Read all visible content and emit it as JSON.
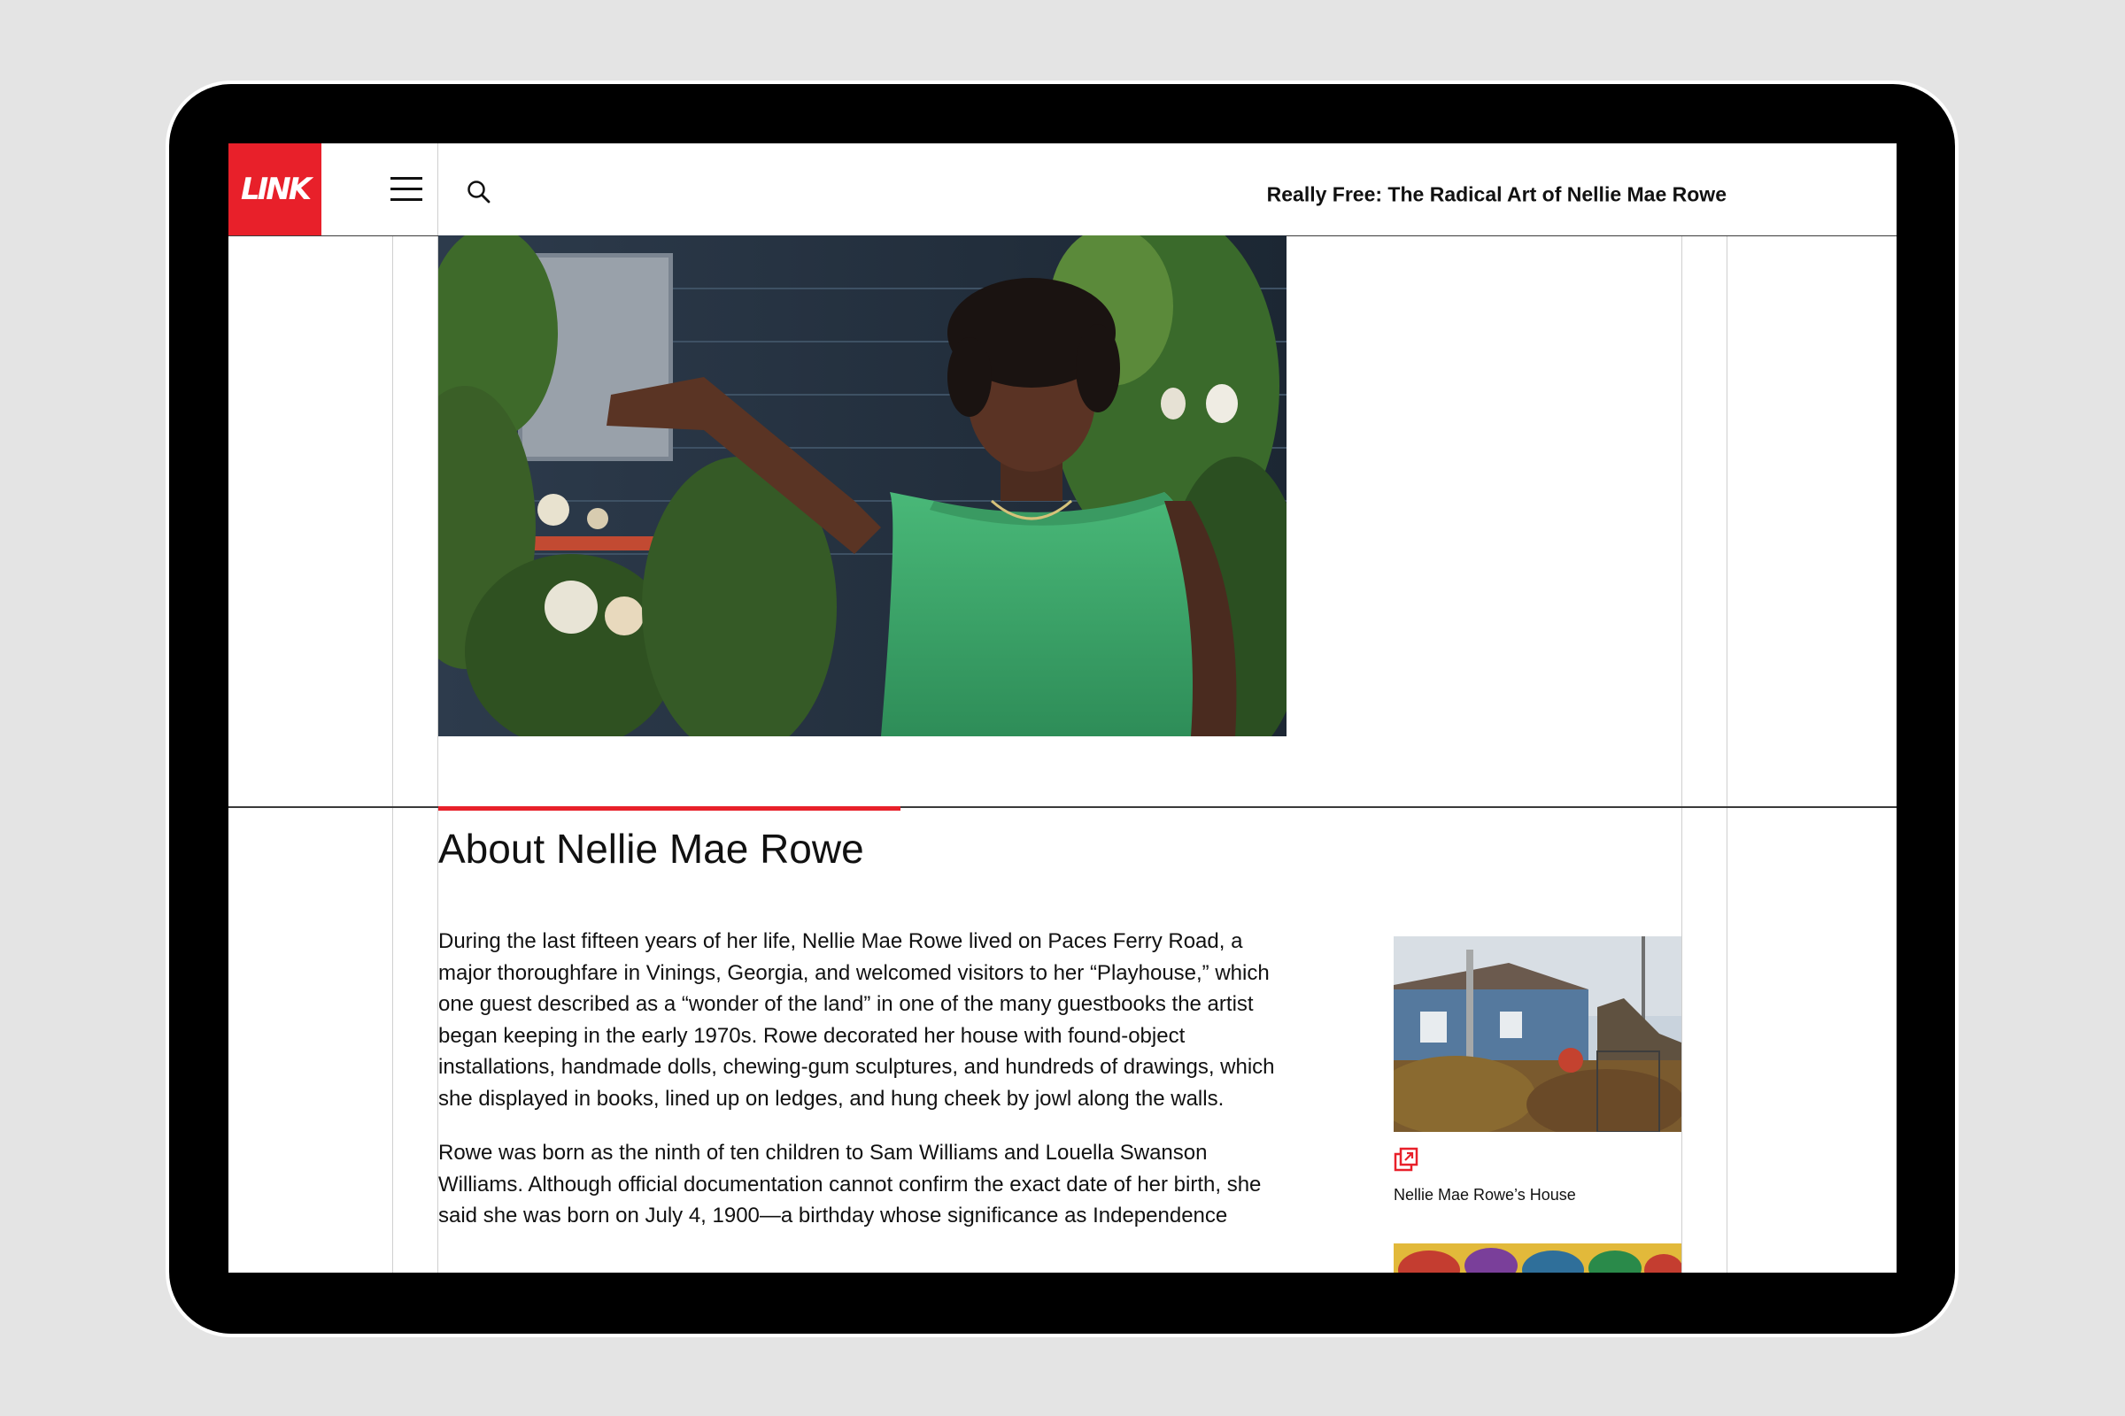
{
  "header": {
    "logo_text": "LINK",
    "title": "Really Free: The Radical Art of Nellie Mae Rowe"
  },
  "icons": {
    "menu": "hamburger-menu-icon",
    "search": "search-icon",
    "expand": "expand-image-icon"
  },
  "colors": {
    "accent": "#e8202a",
    "text": "#111111",
    "background": "#ffffff"
  },
  "section": {
    "title": "About Nellie Mae Rowe",
    "paragraphs": [
      "During the last fifteen years of her life, Nellie Mae Rowe lived on Paces Ferry Road, a major thoroughfare in Vinings, Georgia, and welcomed visitors to her “Playhouse,” which one guest described as a “wonder of the land” in one of the many guestbooks the artist began keeping in the early 1970s. Rowe decorated her house with found-object installations, handmade dolls, chewing-gum sculptures, and hundreds of drawings, which she displayed in books, lined up on ledges, and hung cheek by jowl along the walls.",
      "Rowe was born as the ninth of ten children to Sam Williams and Louella Swanson Williams. Although official documentation cannot confirm the exact date of her birth, she said she was born on July 4, 1900—a birthday whose significance as Independence"
    ]
  },
  "sidebar": {
    "caption": "Nellie Mae Rowe’s House"
  }
}
